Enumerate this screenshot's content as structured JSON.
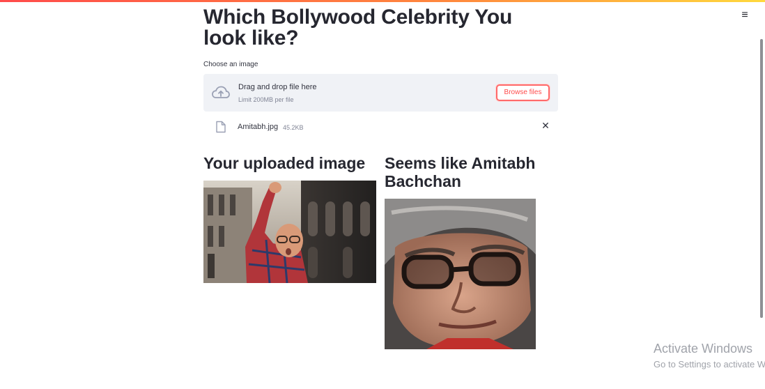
{
  "app": {
    "title": "Which Bollywood Celebrity You look like?",
    "menu_icon": "hamburger-menu-icon"
  },
  "uploader": {
    "label": "Choose an image",
    "drop_text": "Drag and drop file here",
    "limit_text": "Limit 200MB per file",
    "button_label": "Browse files",
    "icon": "cloud-upload-icon"
  },
  "file": {
    "name": "Amitabh.jpg",
    "size": "45.2KB",
    "icon": "file-icon",
    "remove_icon": "close-icon"
  },
  "results": {
    "left_heading": "Your uploaded image",
    "right_heading": "Seems like Amitabh Bachchan"
  },
  "watermark": {
    "line1": "Activate Windows",
    "line2": "Go to Settings to activate Windows."
  },
  "colors": {
    "accent": "#ff4b4b",
    "dropzone_bg": "#f0f2f6",
    "text": "#31333f"
  }
}
